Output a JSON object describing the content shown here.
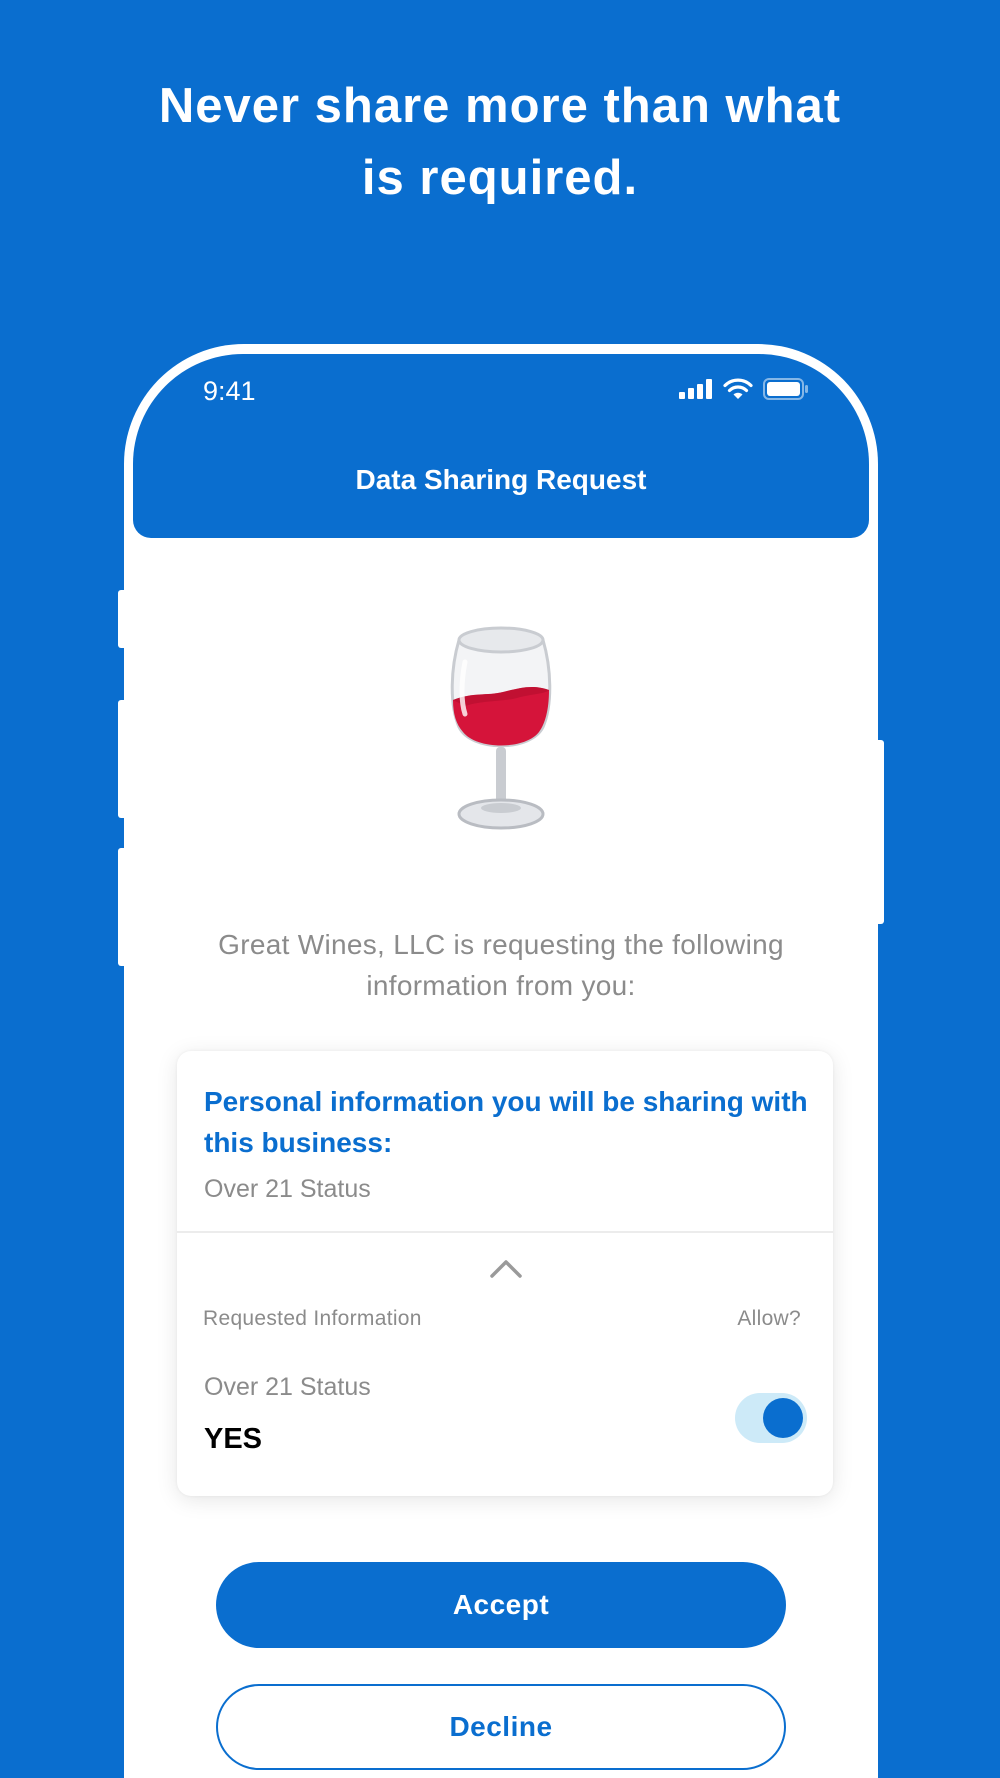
{
  "headline": {
    "line1": "Never share more than what",
    "line2": "is required."
  },
  "status_bar": {
    "time": "9:41",
    "icons": [
      "cellular-signal-icon",
      "wifi-icon",
      "battery-icon"
    ]
  },
  "nav": {
    "title": "Data Sharing Request"
  },
  "request": {
    "icon": "wine-glass-icon",
    "text": "Great Wines, LLC is requesting the following information from you:"
  },
  "card": {
    "heading": "Personal information you will be sharing with this business:",
    "summary": "Over 21 Status",
    "columns": {
      "left": "Requested Information",
      "right": "Allow?"
    },
    "item": {
      "label": "Over 21 Status",
      "value": "YES",
      "allowed": true
    }
  },
  "actions": {
    "accept_label": "Accept",
    "decline_label": "Decline"
  },
  "colors": {
    "brand_blue": "#0A6ECF",
    "toggle_track": "#cdeaf8",
    "muted_text": "#8b8b8b"
  }
}
